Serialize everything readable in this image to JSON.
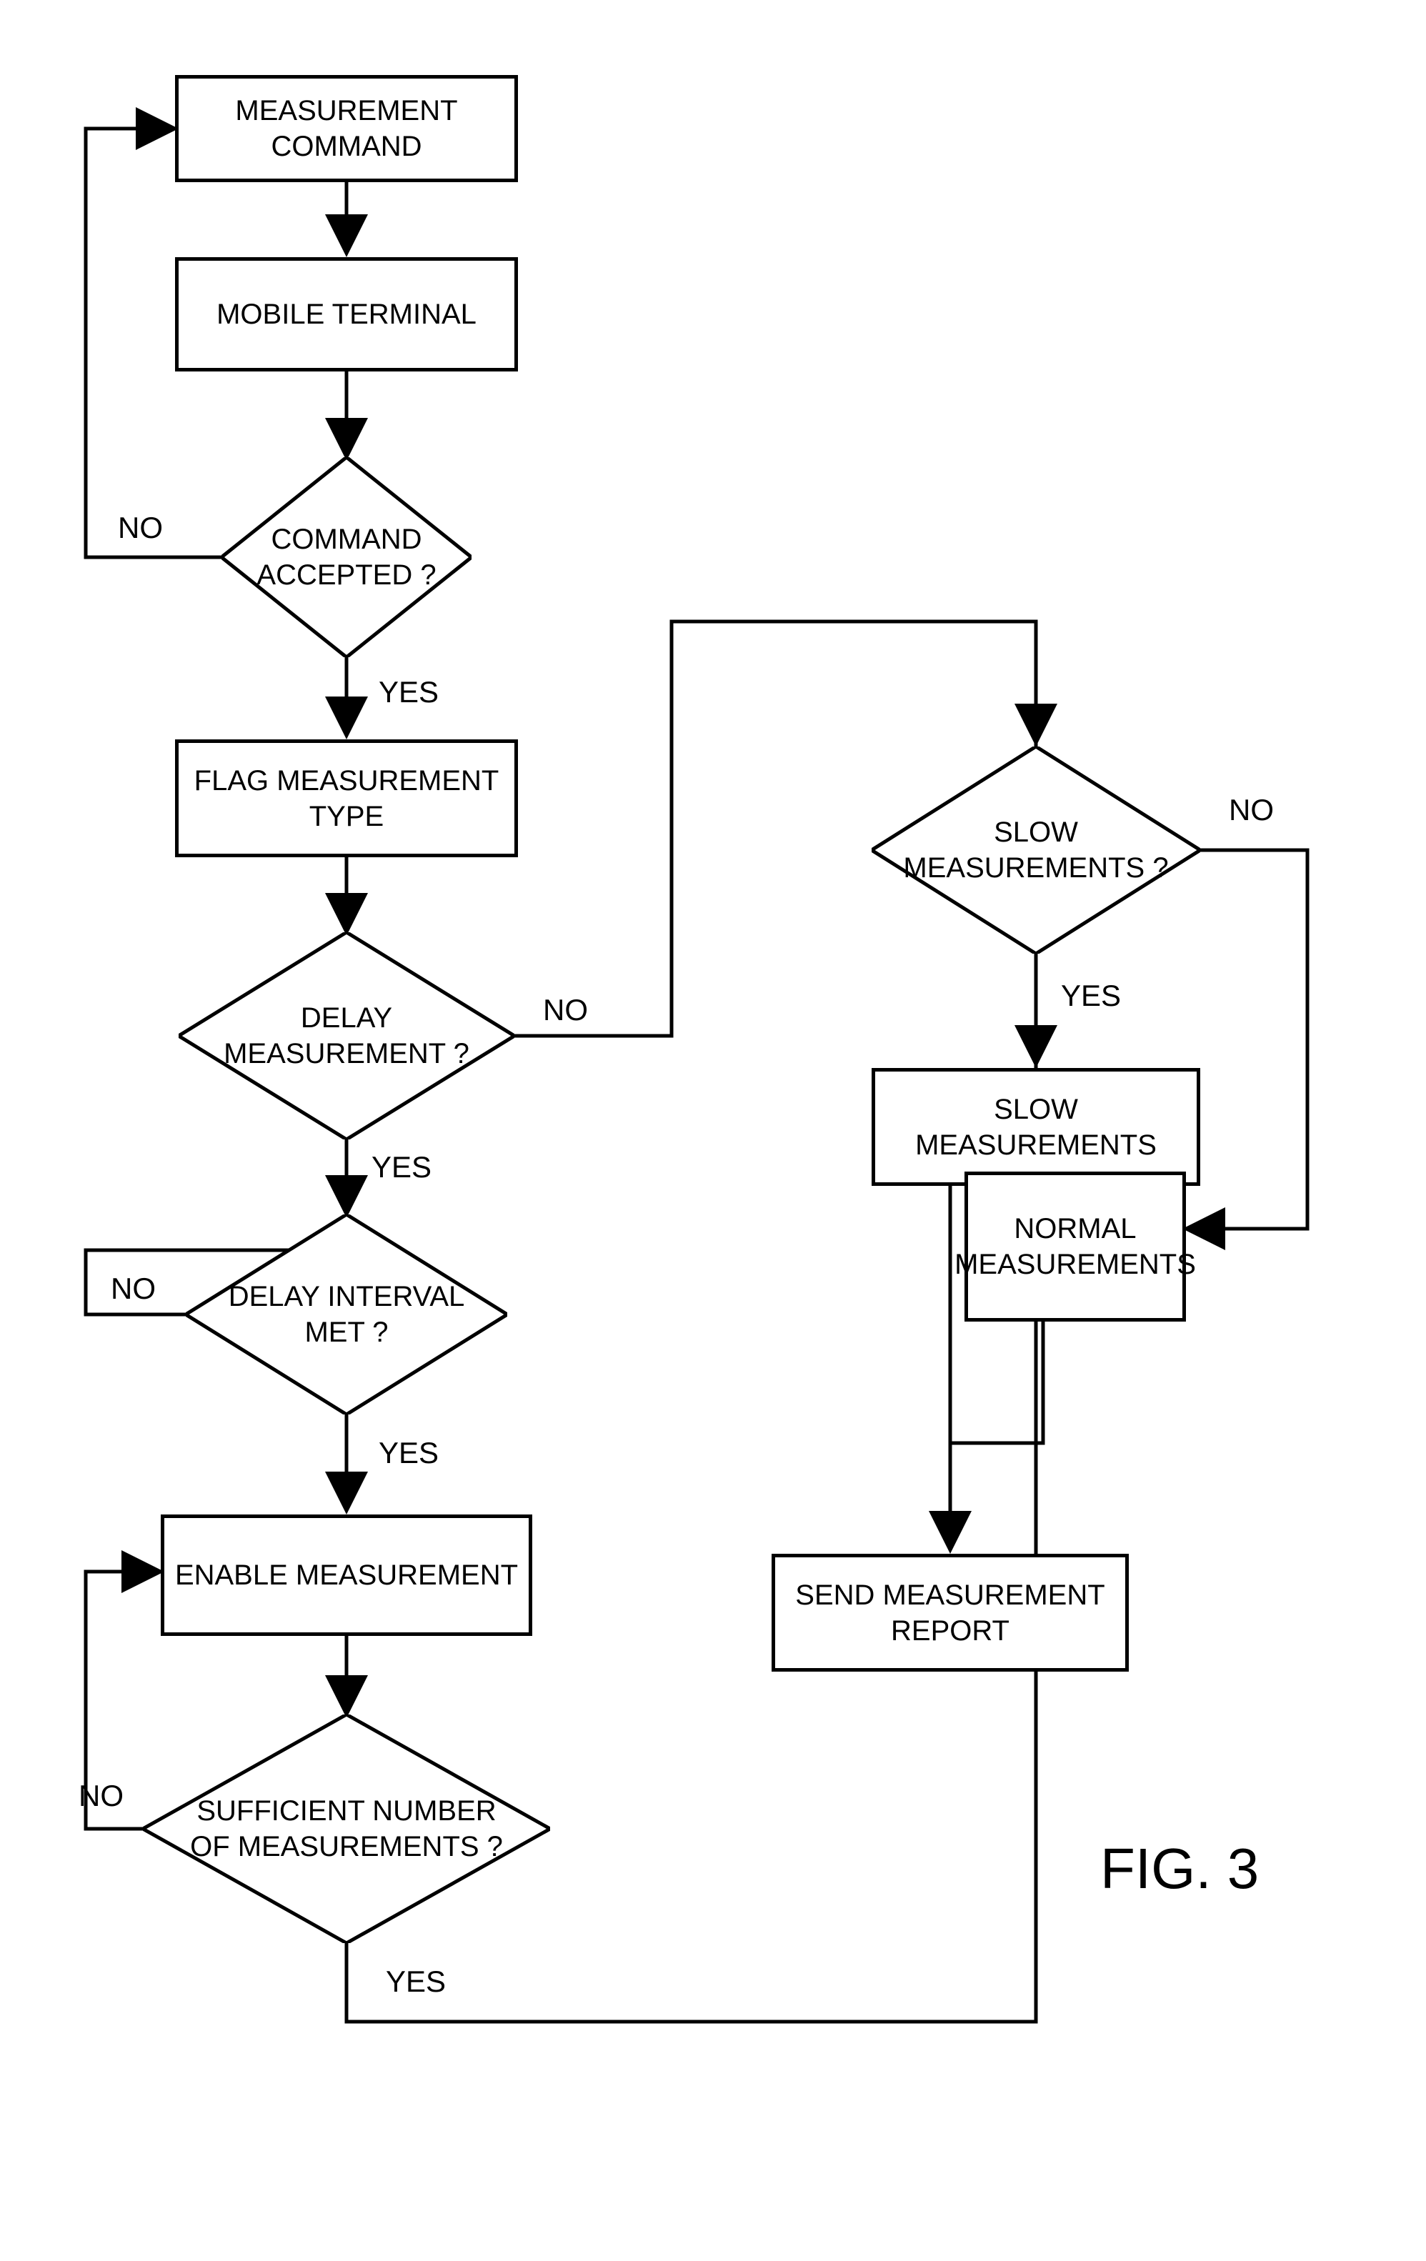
{
  "chart_data": {
    "type": "flowchart",
    "nodes": [
      {
        "id": "n1",
        "shape": "process",
        "text": "MEASUREMENT\nCOMMAND"
      },
      {
        "id": "n2",
        "shape": "process",
        "text": "MOBILE TERMINAL"
      },
      {
        "id": "n3",
        "shape": "decision",
        "text": "COMMAND\nACCEPTED ?"
      },
      {
        "id": "n4",
        "shape": "process",
        "text": "FLAG MEASUREMENT\nTYPE"
      },
      {
        "id": "n5",
        "shape": "decision",
        "text": "DELAY\nMEASUREMENT ?"
      },
      {
        "id": "n6",
        "shape": "decision",
        "text": "DELAY INTERVAL\nMET ?"
      },
      {
        "id": "n7",
        "shape": "process",
        "text": "ENABLE MEASUREMENT"
      },
      {
        "id": "n8",
        "shape": "decision",
        "text": "SUFFICIENT NUMBER\nOF MEASUREMENTS ?"
      },
      {
        "id": "n9",
        "shape": "decision",
        "text": "SLOW\nMEASUREMENTS ?"
      },
      {
        "id": "n10",
        "shape": "process",
        "text": "SLOW\nMEASUREMENTS"
      },
      {
        "id": "n11",
        "shape": "process",
        "text": "NORMAL\nMEASUREMENTS"
      },
      {
        "id": "n12",
        "shape": "process",
        "text": "SEND MEASUREMENT\nREPORT"
      }
    ],
    "edges": [
      {
        "from": "n1",
        "to": "n2",
        "label": ""
      },
      {
        "from": "n2",
        "to": "n3",
        "label": ""
      },
      {
        "from": "n3",
        "to": "n1",
        "label": "NO"
      },
      {
        "from": "n3",
        "to": "n4",
        "label": "YES"
      },
      {
        "from": "n4",
        "to": "n5",
        "label": ""
      },
      {
        "from": "n5",
        "to": "n9",
        "label": "NO",
        "via": "right-up"
      },
      {
        "from": "n5",
        "to": "n6",
        "label": "YES"
      },
      {
        "from": "n6",
        "to": "self",
        "label": "NO",
        "via": "left-loop"
      },
      {
        "from": "n6",
        "to": "n7",
        "label": "YES"
      },
      {
        "from": "n7",
        "to": "n8",
        "label": ""
      },
      {
        "from": "n8",
        "to": "n7",
        "label": "NO",
        "via": "left-loop"
      },
      {
        "from": "n8",
        "to": "n9",
        "label": "YES",
        "via": "down-right-up"
      },
      {
        "from": "n9",
        "to": "n10",
        "label": "YES"
      },
      {
        "from": "n9",
        "to": "n11",
        "label": "NO"
      },
      {
        "from": "n10",
        "to": "n12",
        "label": ""
      },
      {
        "from": "n11",
        "to": "n12",
        "label": ""
      }
    ],
    "figure_label": "FIG. 3"
  },
  "labels": {
    "yes": "YES",
    "no": "NO"
  }
}
